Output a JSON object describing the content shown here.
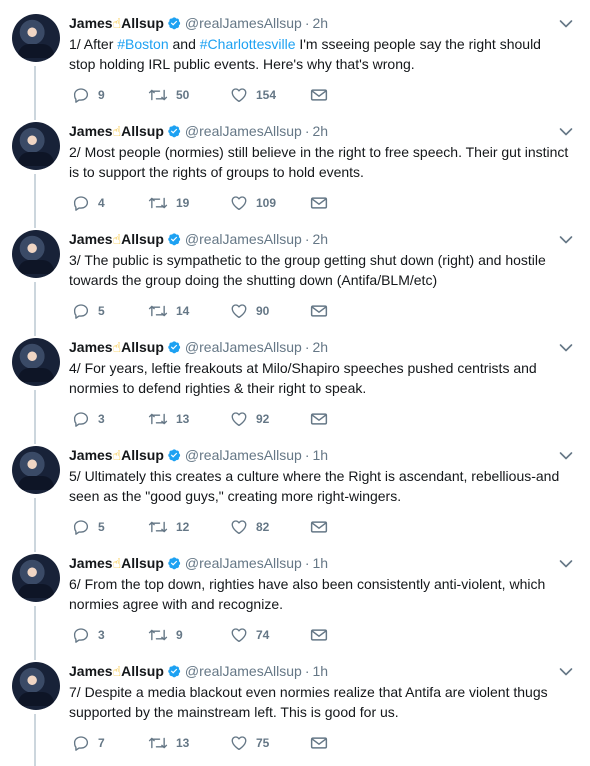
{
  "tweets": [
    {
      "name": "James",
      "name_emoji": "☝",
      "name_suffix": "Allsup",
      "handle": "@realJamesAllsup",
      "time": "2h",
      "text_html": "1/ After <span class=\"hashtag\">#Boston</span> and <span class=\"hashtag\">#Charlottesville</span> I'm sseeing people say the right should stop holding IRL public events. Here's why that's wrong.",
      "replies": "9",
      "retweets": "50",
      "likes": "154"
    },
    {
      "name": "James",
      "name_emoji": "☝",
      "name_suffix": "Allsup",
      "handle": "@realJamesAllsup",
      "time": "2h",
      "text_html": "2/ Most people (normies) still believe in the right to free speech. Their gut instinct is to support the rights of groups to hold events.",
      "replies": "4",
      "retweets": "19",
      "likes": "109"
    },
    {
      "name": "James",
      "name_emoji": "☝",
      "name_suffix": "Allsup",
      "handle": "@realJamesAllsup",
      "time": "2h",
      "text_html": "3/ The public is sympathetic to the group getting shut down (right) and hostile towards the group doing the shutting down (Antifa/BLM/etc)",
      "replies": "5",
      "retweets": "14",
      "likes": "90"
    },
    {
      "name": "James",
      "name_emoji": "☝",
      "name_suffix": "Allsup",
      "handle": "@realJamesAllsup",
      "time": "2h",
      "text_html": "4/ For years, leftie freakouts at Milo/Shapiro speeches pushed centrists and normies to defend righties &amp; their right to speak.",
      "replies": "3",
      "retweets": "13",
      "likes": "92"
    },
    {
      "name": "James",
      "name_emoji": "☝",
      "name_suffix": "Allsup",
      "handle": "@realJamesAllsup",
      "time": "1h",
      "text_html": "5/ Ultimately this creates a culture where the Right is ascendant, rebellious-and seen as the \"good guys,\" creating more right-wingers.",
      "replies": "5",
      "retweets": "12",
      "likes": "82"
    },
    {
      "name": "James",
      "name_emoji": "☝",
      "name_suffix": "Allsup",
      "handle": "@realJamesAllsup",
      "time": "1h",
      "text_html": "6/ From the top down, righties have also been consistently anti-violent, which normies agree with and recognize.",
      "replies": "3",
      "retweets": "9",
      "likes": "74"
    },
    {
      "name": "James",
      "name_emoji": "☝",
      "name_suffix": "Allsup",
      "handle": "@realJamesAllsup",
      "time": "1h",
      "text_html": "7/ Despite a media blackout even normies realize that Antifa are violent thugs supported by the mainstream left. This is good for us.",
      "replies": "7",
      "retweets": "13",
      "likes": "75"
    }
  ],
  "colors": {
    "text": "#14171a",
    "muted": "#657786",
    "accent": "#1da1f2",
    "thread_line": "#ccd6dd"
  },
  "icons": {
    "verified": "verified-badge-icon",
    "caret": "chevron-down-icon",
    "reply": "reply-icon",
    "retweet": "retweet-icon",
    "like": "heart-icon",
    "dm": "envelope-icon"
  }
}
